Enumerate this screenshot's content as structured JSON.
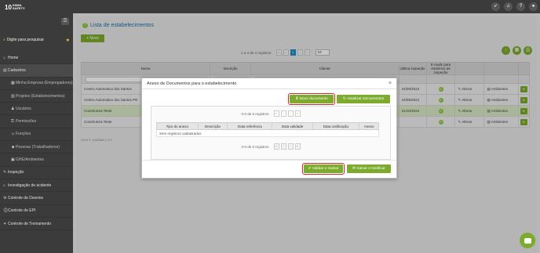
{
  "brand": {
    "logo": "10",
    "sub_top": "SSMA",
    "sub_bottom": "SAFETY"
  },
  "sidebar": {
    "search_label": "Digite para pesquisar",
    "items": [
      {
        "label": "Home",
        "icon": "home-icon",
        "sub": false
      },
      {
        "label": "Cadastros",
        "icon": "folder-icon",
        "sub": false
      },
      {
        "label": "Minha Empresa (Empregadores)",
        "icon": "building-icon",
        "sub": true
      },
      {
        "label": "Projetos (Estabelecimentos)",
        "icon": "projects-icon",
        "sub": true
      },
      {
        "label": "Usuários",
        "icon": "user-icon",
        "sub": true
      },
      {
        "label": "Permissões",
        "icon": "key-icon",
        "sub": true
      },
      {
        "label": "Funções",
        "icon": "users-icon",
        "sub": true
      },
      {
        "label": "Pessoas (Trabalhadores)",
        "icon": "people-icon",
        "sub": true
      },
      {
        "label": "GHE/Ambientes",
        "icon": "env-icon",
        "sub": true
      },
      {
        "label": "Inspeção",
        "icon": "inspection-icon",
        "sub": false
      },
      {
        "label": "Investigação de acidente",
        "icon": "search-icon",
        "sub": false
      },
      {
        "label": "Controle de Desvios",
        "icon": "control-icon",
        "sub": false
      },
      {
        "label": "Controle de EPI",
        "icon": "epi-icon",
        "sub": false
      },
      {
        "label": "Controle de Treinamento",
        "icon": "training-icon",
        "sub": false
      }
    ]
  },
  "topbar": {
    "icons": [
      "rocket-icon",
      "bell-icon",
      "help-icon",
      "profile-icon"
    ]
  },
  "page": {
    "title": "Lista de estabelecimentos",
    "new_button": "Novo",
    "pager_info": "1 a 4 de 4 registros",
    "current_page": "1",
    "page_size": "10",
    "columns": [
      "Nome",
      "Inscrição",
      "Cliente",
      "Última inspeção",
      "E-mails para relatórios de inspeção",
      "",
      "",
      ""
    ],
    "rows": [
      {
        "nome": "Centro Automotivo dos Santos",
        "data": "24/09/2024",
        "emails": "0",
        "edit": "Alterar",
        "amb": "Ambientes"
      },
      {
        "nome": "Centro Automotivo dos Santos PR",
        "data": "24/09/2024",
        "emails": "0",
        "edit": "Alterar",
        "amb": "Ambientes"
      },
      {
        "nome": "Construtora Teste",
        "data": "21/10/2024",
        "emails": "0",
        "edit": "Alterar",
        "amb": "Ambientes"
      },
      {
        "nome": "Construtora Teste",
        "data": "",
        "emails": "0",
        "edit": "Alterar",
        "amb": "Ambientes"
      }
    ],
    "version": "2024 © 10SSMA 1.0.0"
  },
  "modal": {
    "title": "Anexo de Documentos para o estabelecimento",
    "close": "×",
    "btn_new_doc": "Novo documento",
    "btn_update_docs": "Atualizar Documentos",
    "pager_info": "0-0 de 0 registros",
    "columns": [
      "Tipo do anexo",
      "Descrição",
      "Data referência",
      "Data validade",
      "Data notificação",
      "Anexo"
    ],
    "empty_text": "Sem registros cadastrados",
    "btn_validate": "Validar e Salvar",
    "btn_notify": "Salvar e Notificar"
  },
  "colors": {
    "accent": "#7dab2d",
    "highlight": "#d9262c",
    "title": "#1e74a8"
  }
}
